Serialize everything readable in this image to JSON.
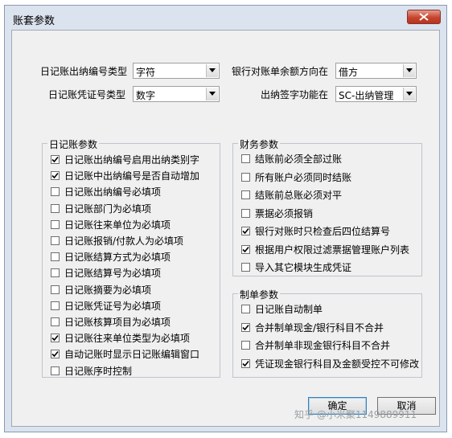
{
  "window": {
    "title": "账套参数"
  },
  "top_fields": [
    {
      "label": "日记账出纳编号类型",
      "value": "字符"
    },
    {
      "label": "日记账凭证号类型",
      "value": "数字"
    },
    {
      "label": "银行对账单余额方向在",
      "value": "借方"
    },
    {
      "label": "出纳签字功能在",
      "value": "SC-出纳管理"
    }
  ],
  "journal_group": {
    "title": "日记账参数",
    "items": [
      {
        "label": "日记账出纳编号启用出纳类别字",
        "checked": true
      },
      {
        "label": "日记账中出纳编号是否自动增加",
        "checked": true
      },
      {
        "label": "日记账出纳编号必填项",
        "checked": false
      },
      {
        "label": "日记账部门为必填项",
        "checked": false
      },
      {
        "label": "日记账往来单位为必填项",
        "checked": false
      },
      {
        "label": "日记账报销/付款人为必填项",
        "checked": false
      },
      {
        "label": "日记账结算方式为必填项",
        "checked": false
      },
      {
        "label": "日记账结算号为必填项",
        "checked": false
      },
      {
        "label": "日记账摘要为必填项",
        "checked": false
      },
      {
        "label": "日记账凭证号为必填项",
        "checked": false
      },
      {
        "label": "日记账核算项目为必填项",
        "checked": false
      },
      {
        "label": "日记账往来单位类型为必填项",
        "checked": true
      },
      {
        "label": "自动记账时显示日记账编辑窗口",
        "checked": true
      },
      {
        "label": "日记账序时控制",
        "checked": false
      }
    ]
  },
  "finance_group": {
    "title": "财务参数",
    "items": [
      {
        "label": "结账前必须全部过账",
        "checked": false
      },
      {
        "label": "所有账户必须同时结账",
        "checked": false
      },
      {
        "label": "结账前总账必须对平",
        "checked": false
      },
      {
        "label": "票据必须报销",
        "checked": false
      },
      {
        "label": "银行对账时只检查后四位结算号",
        "checked": true
      },
      {
        "label": "根据用户权限过滤票据管理账户列表",
        "checked": true
      },
      {
        "label": "导入其它模块生成凭证",
        "checked": false
      }
    ]
  },
  "voucher_group": {
    "title": "制单参数",
    "items": [
      {
        "label": "日记账自动制单",
        "checked": false
      },
      {
        "label": "合并制单现金/银行科目不合并",
        "checked": true
      },
      {
        "label": "合并制单非现金银行科目不合并",
        "checked": false
      },
      {
        "label": "凭证现金银行科目及金额受控不可修改",
        "checked": true
      }
    ]
  },
  "buttons": {
    "ok": "确定",
    "cancel": "取消"
  },
  "watermark": "知乎 @小米聚1149889911"
}
